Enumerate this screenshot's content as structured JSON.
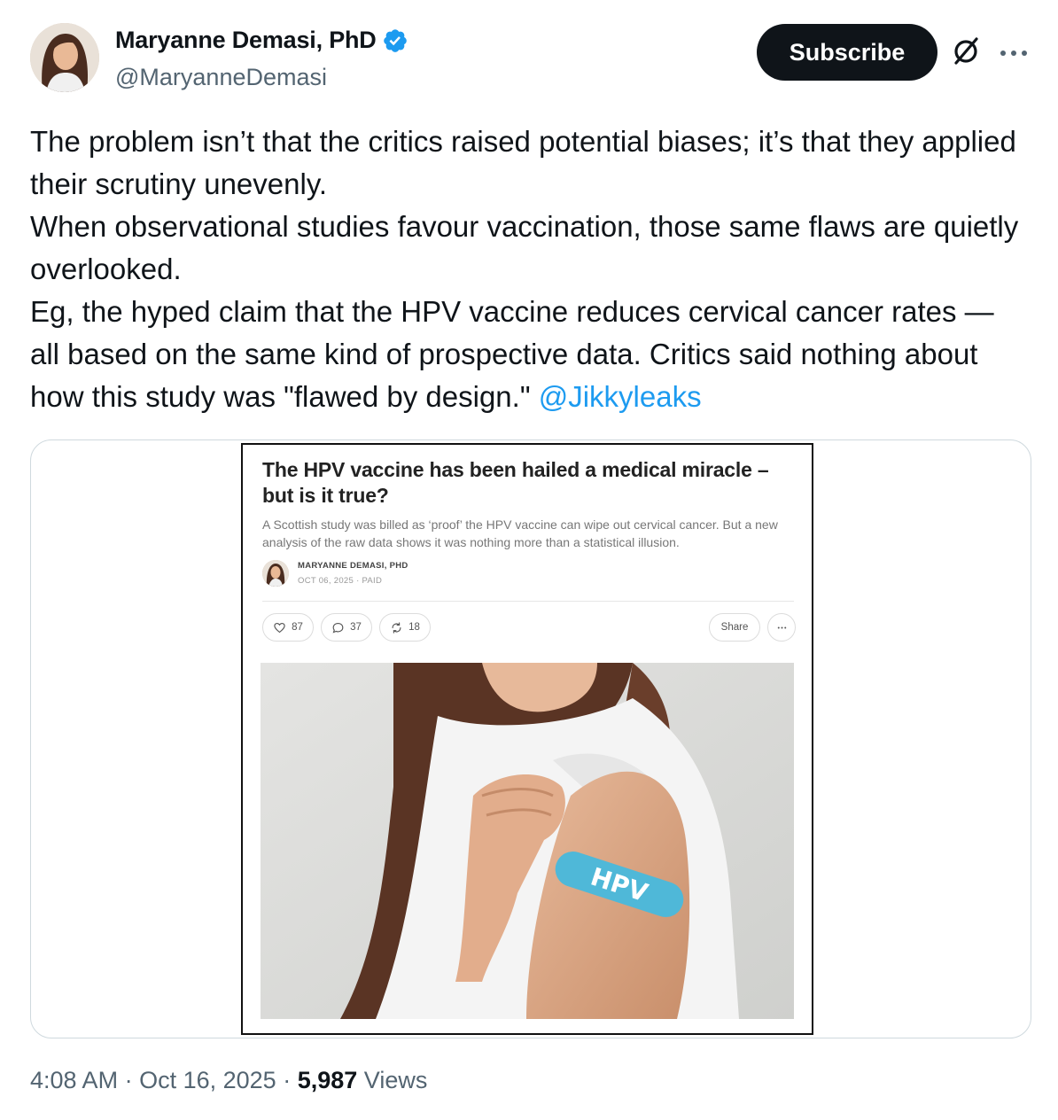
{
  "author": {
    "display_name": "Maryanne Demasi, PhD",
    "handle": "@MaryanneDemasi",
    "verified_icon": "verified-badge-icon",
    "verified_color": "#1d9bf0"
  },
  "header": {
    "subscribe_label": "Subscribe"
  },
  "tweet": {
    "lines": [
      "The problem isn’t that the critics raised potential biases; it’s that they applied their scrutiny unevenly.",
      "When observational studies favour vaccination, those same flaws are quietly overlooked.",
      "Eg, the hyped claim that the HPV vaccine reduces cervical cancer rates — all based on the same kind of prospective data. Critics said nothing about how this study was \"flawed by design.\""
    ],
    "mention": "@Jikkyleaks",
    "mention_color": "#1d9bf0"
  },
  "article": {
    "title": "The HPV vaccine has been hailed a medical miracle – but is it true?",
    "subtitle": "A Scottish study was billed as ‘proof’ the HPV vaccine can wipe out cervical cancer. But a new analysis of the raw data shows it was nothing more than a statistical illusion.",
    "author": "MARYANNE DEMASI, PHD",
    "date": "OCT 06, 2025",
    "access": "PAID",
    "likes": "87",
    "comments": "37",
    "restacks": "18",
    "share_label": "Share",
    "bandage_text": "HPV",
    "bandage_color": "#4fb8d8"
  },
  "meta": {
    "time": "4:08 AM",
    "date": "Oct 16, 2025",
    "views_count": "5,987",
    "views_label": "Views"
  }
}
